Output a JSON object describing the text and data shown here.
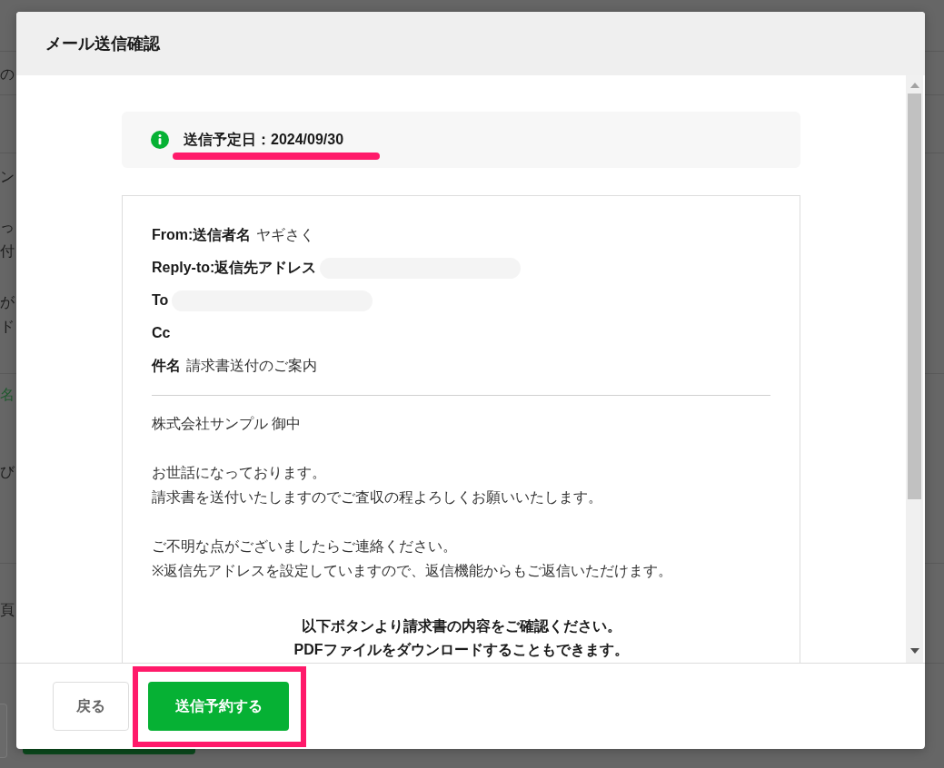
{
  "background_page": {
    "sections": [
      {
        "fragments": [
          {
            "text": "の",
            "kind": "text"
          }
        ]
      },
      {
        "fragments": [
          {
            "text": "ン",
            "kind": "text"
          },
          {
            "text": "っ",
            "kind": "text"
          },
          {
            "text": "付",
            "kind": "text"
          },
          {
            "text": "が",
            "kind": "text"
          },
          {
            "text": "ド",
            "kind": "text"
          }
        ]
      },
      {
        "fragments": [
          {
            "text": "名",
            "kind": "link"
          },
          {
            "text": "び",
            "kind": "text"
          }
        ]
      },
      {
        "fragments": [
          {
            "text": "頁",
            "kind": "text"
          }
        ]
      }
    ]
  },
  "dialog": {
    "title": "メール送信確認"
  },
  "schedule": {
    "text": "送信予定日：2024/09/30",
    "highlighted": true
  },
  "email": {
    "header_fields": [
      {
        "label": "From:送信者名",
        "value": "ヤギさく",
        "redacted": false
      },
      {
        "label": "Reply-to:返信先アドレス",
        "redacted": true
      },
      {
        "label": "To",
        "redacted": true
      },
      {
        "label": "Cc",
        "redacted": false
      },
      {
        "label": "件名",
        "value": "請求書送付のご案内",
        "redacted": false
      }
    ],
    "body_paragraphs": [
      {
        "kind": "plain",
        "lines": [
          "株式会社サンプル 御中"
        ]
      },
      {
        "kind": "plain",
        "lines": [
          "お世話になっております。",
          "請求書を送付いたしますのでご査収の程よろしくお願いいたします。"
        ]
      },
      {
        "kind": "plain",
        "lines": [
          "ご不明な点がございましたらご連絡ください。",
          "※返信先アドレスを設定していますので、返信機能からもご返信いただけます。"
        ]
      },
      {
        "kind": "notice",
        "lines": [
          "以下ボタンより請求書の内容をご確認ください。",
          "PDFファイルをダウンロードすることもできます。"
        ]
      }
    ]
  },
  "buttons": [
    {
      "label": "戻る",
      "kind": "secondary",
      "highlighted": false
    },
    {
      "label": "送信予約する",
      "kind": "primary",
      "highlighted": true
    }
  ]
}
